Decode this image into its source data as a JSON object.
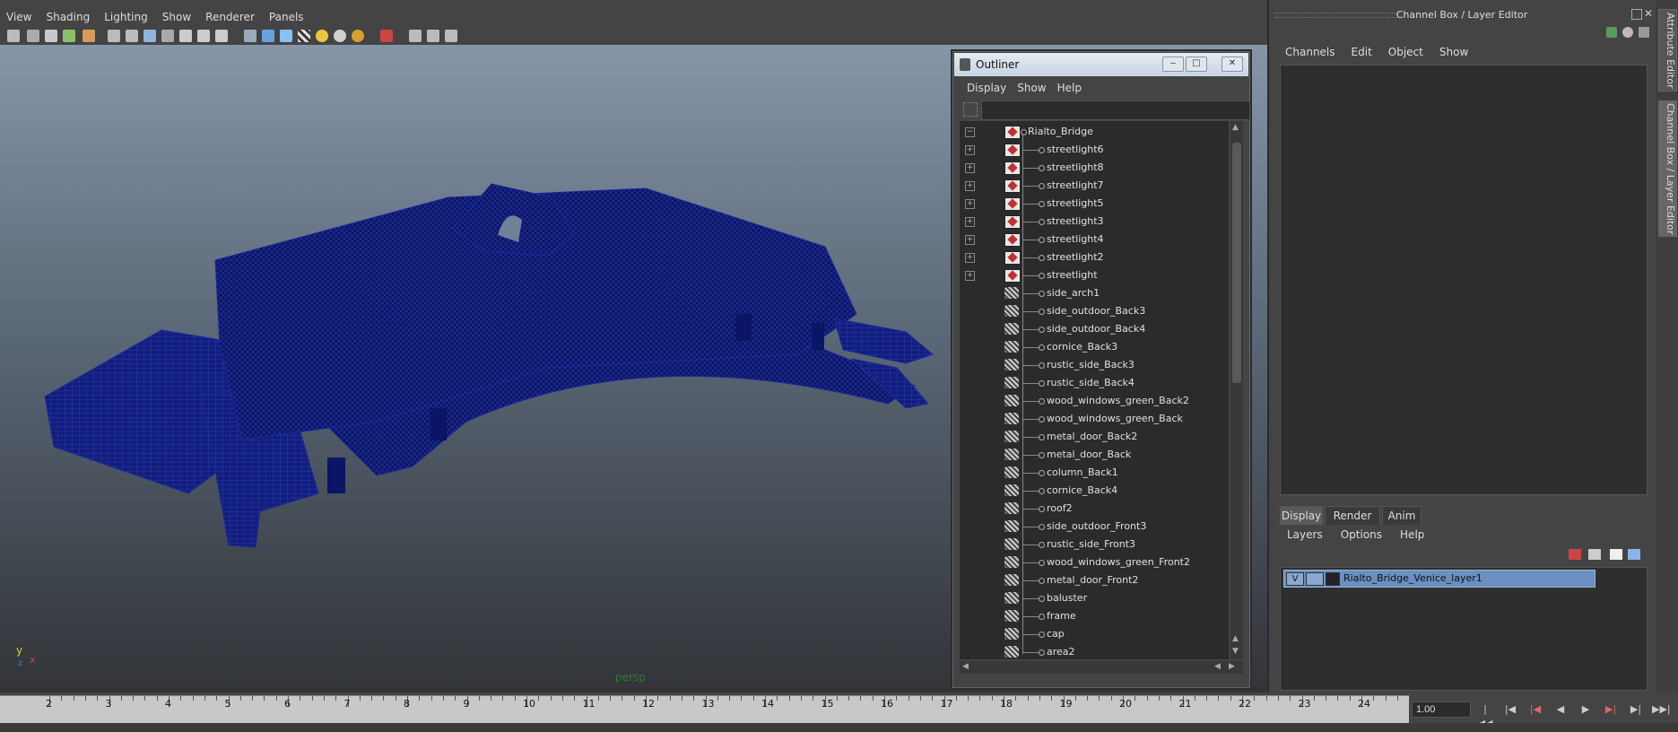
{
  "viewport": {
    "menu": [
      "View",
      "Shading",
      "Lighting",
      "Show",
      "Renderer",
      "Panels"
    ],
    "camera_label": "persp",
    "axis": {
      "y": "y",
      "x": "x",
      "z": "z"
    }
  },
  "outliner": {
    "title": "Outliner",
    "menu": [
      "Display",
      "Show",
      "Help"
    ],
    "filter_value": "",
    "root": "Rialto_Bridge",
    "items": [
      {
        "name": "streetlight6",
        "type": "light",
        "expandable": true
      },
      {
        "name": "streetlight8",
        "type": "light",
        "expandable": true
      },
      {
        "name": "streetlight7",
        "type": "light",
        "expandable": true
      },
      {
        "name": "streetlight5",
        "type": "light",
        "expandable": true
      },
      {
        "name": "streetlight3",
        "type": "light",
        "expandable": true
      },
      {
        "name": "streetlight4",
        "type": "light",
        "expandable": true
      },
      {
        "name": "streetlight2",
        "type": "light",
        "expandable": true
      },
      {
        "name": "streetlight",
        "type": "light",
        "expandable": true
      },
      {
        "name": "side_arch1",
        "type": "mesh",
        "expandable": false
      },
      {
        "name": "side_outdoor_Back3",
        "type": "mesh",
        "expandable": false
      },
      {
        "name": "side_outdoor_Back4",
        "type": "mesh",
        "expandable": false
      },
      {
        "name": "cornice_Back3",
        "type": "mesh",
        "expandable": false
      },
      {
        "name": "rustic_side_Back3",
        "type": "mesh",
        "expandable": false
      },
      {
        "name": "rustic_side_Back4",
        "type": "mesh",
        "expandable": false
      },
      {
        "name": "wood_windows_green_Back2",
        "type": "mesh",
        "expandable": false
      },
      {
        "name": "wood_windows_green_Back",
        "type": "mesh",
        "expandable": false
      },
      {
        "name": "metal_door_Back2",
        "type": "mesh",
        "expandable": false
      },
      {
        "name": "metal_door_Back",
        "type": "mesh",
        "expandable": false
      },
      {
        "name": "column_Back1",
        "type": "mesh",
        "expandable": false
      },
      {
        "name": "cornice_Back4",
        "type": "mesh",
        "expandable": false
      },
      {
        "name": "roof2",
        "type": "mesh",
        "expandable": false
      },
      {
        "name": "side_outdoor_Front3",
        "type": "mesh",
        "expandable": false
      },
      {
        "name": "rustic_side_Front3",
        "type": "mesh",
        "expandable": false
      },
      {
        "name": "wood_windows_green_Front2",
        "type": "mesh",
        "expandable": false
      },
      {
        "name": "metal_door_Front2",
        "type": "mesh",
        "expandable": false
      },
      {
        "name": "baluster",
        "type": "mesh",
        "expandable": false
      },
      {
        "name": "frame",
        "type": "mesh",
        "expandable": false
      },
      {
        "name": "cap",
        "type": "mesh",
        "expandable": false
      },
      {
        "name": "area2",
        "type": "mesh",
        "expandable": false
      }
    ]
  },
  "channel_box": {
    "title": "Channel Box / Layer Editor",
    "menu": [
      "Channels",
      "Edit",
      "Object",
      "Show"
    ]
  },
  "layer_editor": {
    "tabs": [
      "Display",
      "Render",
      "Anim"
    ],
    "active_tab": "Display",
    "menu": [
      "Layers",
      "Options",
      "Help"
    ],
    "layers": [
      {
        "visible": "V",
        "name": "Rialto_Bridge_Venice_layer1"
      }
    ]
  },
  "side_tabs": [
    "Attribute Editor",
    "Channel Box / Layer Editor"
  ],
  "timeline": {
    "ticks": [
      "2",
      "3",
      "4",
      "5",
      "6",
      "7",
      "8",
      "9",
      "10",
      "11",
      "12",
      "13",
      "14",
      "15",
      "16",
      "17",
      "18",
      "19",
      "20",
      "21",
      "22",
      "23",
      "24"
    ],
    "current_frame": "1.00"
  },
  "colors": {
    "wireframe": "#0d1a7a",
    "layer_selected": "#6a8fc0",
    "light_icon": "#c23030"
  }
}
